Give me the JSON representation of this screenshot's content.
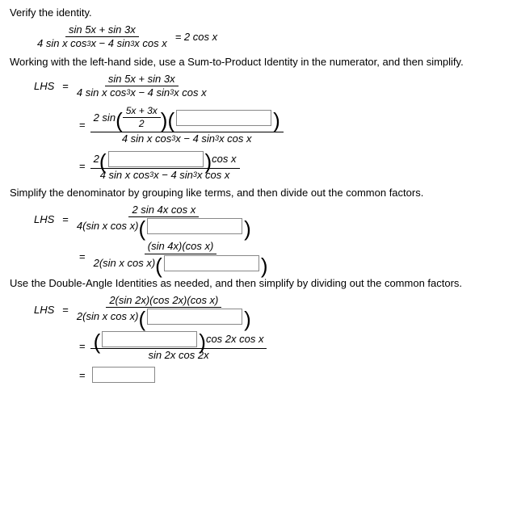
{
  "title": "Verify the identity.",
  "identity": {
    "num": "sin 5x + sin 3x",
    "den_a": "4 sin x cos",
    "den_b": " x − 4 sin",
    "den_c": " x cos x",
    "rhs": "= 2 cos x"
  },
  "instr1": "Working with the left-hand side, use a Sum-to-Product Identity in the numerator, and then simplify.",
  "lhs": "LHS",
  "step1": {
    "num": "sin 5x + sin 3x",
    "den_a": "4 sin x cos",
    "den_b": " x − 4 sin",
    "den_c": " x cos x"
  },
  "step2": {
    "pre": "2 sin",
    "inner_num": "5x + 3x",
    "inner_den": "2",
    "den_a": "4 sin x cos",
    "den_b": " x − 4 sin",
    "den_c": " x cos x"
  },
  "step3": {
    "pre": "2",
    "post": "cos x",
    "den_a": "4 sin x cos",
    "den_b": " x − 4 sin",
    "den_c": " x cos x"
  },
  "instr2": "Simplify the denominator by grouping like terms, and then divide out the common factors.",
  "step4": {
    "num": "2 sin 4x cos x",
    "den_pre": "4(sin x cos x)"
  },
  "step5": {
    "num": "(sin 4x)(cos x)",
    "den_pre": "2(sin x cos x)"
  },
  "instr3": "Use the Double-Angle Identities as needed, and then simplify by dividing out the common factors.",
  "step6": {
    "num": "2(sin 2x)(cos 2x)(cos x)",
    "den_pre": "2(sin x cos x)"
  },
  "step7": {
    "post": "cos 2x cos x",
    "den": "sin 2x cos 2x"
  }
}
